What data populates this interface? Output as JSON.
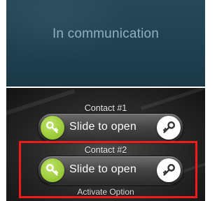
{
  "status": {
    "text": "In communication"
  },
  "contacts": [
    {
      "label": "Contact #1",
      "slider_label": "Slide to open"
    },
    {
      "label": "Contact #2",
      "slider_label": "Slide to open"
    }
  ],
  "activate_option": "Activate Option",
  "colors": {
    "panel_bg": "#26495a",
    "status_text": "#8fb0bf",
    "knob_green": "#9ccc3a",
    "highlight_red": "#ee1c1c"
  },
  "icons": {
    "knob": "key-icon",
    "end": "key-icon"
  }
}
